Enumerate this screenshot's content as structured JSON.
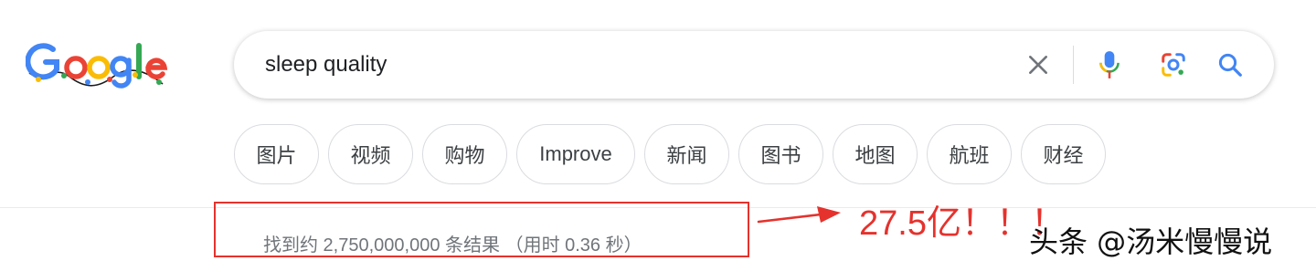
{
  "logo": {
    "text": "Google"
  },
  "search": {
    "query": "sleep quality",
    "clear_icon": "close-icon",
    "voice_icon": "mic-icon",
    "lens_icon": "camera-lens-icon",
    "search_icon": "search-icon"
  },
  "chips": [
    {
      "label": "图片"
    },
    {
      "label": "视频"
    },
    {
      "label": "购物"
    },
    {
      "label": "Improve"
    },
    {
      "label": "新闻"
    },
    {
      "label": "图书"
    },
    {
      "label": "地图"
    },
    {
      "label": "航班"
    },
    {
      "label": "财经"
    }
  ],
  "results": {
    "stats": "找到约 2,750,000,000 条结果 （用时 0.36 秒）"
  },
  "annotation": {
    "text": "27.5亿！！！",
    "color": "#e5322d"
  },
  "watermark": {
    "text": "头条 @汤米慢慢说"
  },
  "colors": {
    "google_blue": "#4285f4",
    "google_red": "#ea4335",
    "google_yellow": "#fbbc05",
    "google_green": "#34a853",
    "stats_gray": "#70757a"
  }
}
